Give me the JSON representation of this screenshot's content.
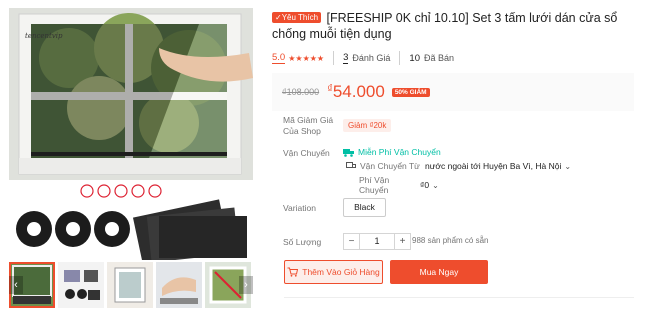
{
  "gallery": {
    "watermark": "tencentvip",
    "thumbnail_count": 5,
    "prev_icon": "chevron-left-icon",
    "next_icon": "chevron-right-icon"
  },
  "product": {
    "badge": "Yêu Thích",
    "title": "[FREESHIP 0K chỉ 10.10] Set 3 tấm lưới dán cửa sổ chống muỗi tiện dụng",
    "rating": "5.0",
    "stars": "★★★★★",
    "review_count": "3",
    "review_label": "Đánh Giá",
    "sold_count": "10",
    "sold_label": "Đã Bán"
  },
  "price": {
    "original": "₫108.000",
    "currency": "₫",
    "current": "54.000",
    "discount": "50% GIẢM"
  },
  "voucher": {
    "label": "Mã Giảm Giá Của Shop",
    "tag": "Giảm ₫20k"
  },
  "shipping": {
    "label": "Vận Chuyển",
    "free": "Miễn Phí Vận Chuyển",
    "from_label": "Vận Chuyển Từ",
    "from_value": "nước ngoài tới Huyện Ba Vì, Hà Nội",
    "fee_label": "Phí Vận Chuyển",
    "fee_value": "₫0"
  },
  "variation": {
    "label": "Variation",
    "selected": "Black"
  },
  "quantity": {
    "label": "Số Lượng",
    "minus": "−",
    "value": "1",
    "plus": "+",
    "stock": "988 sản phẩm có sẵn"
  },
  "actions": {
    "add_to_cart": "Thêm Vào Giỏ Hàng",
    "buy_now": "Mua Ngay"
  },
  "colors": {
    "accent": "#ee4d2d",
    "teal": "#00bfa5"
  }
}
